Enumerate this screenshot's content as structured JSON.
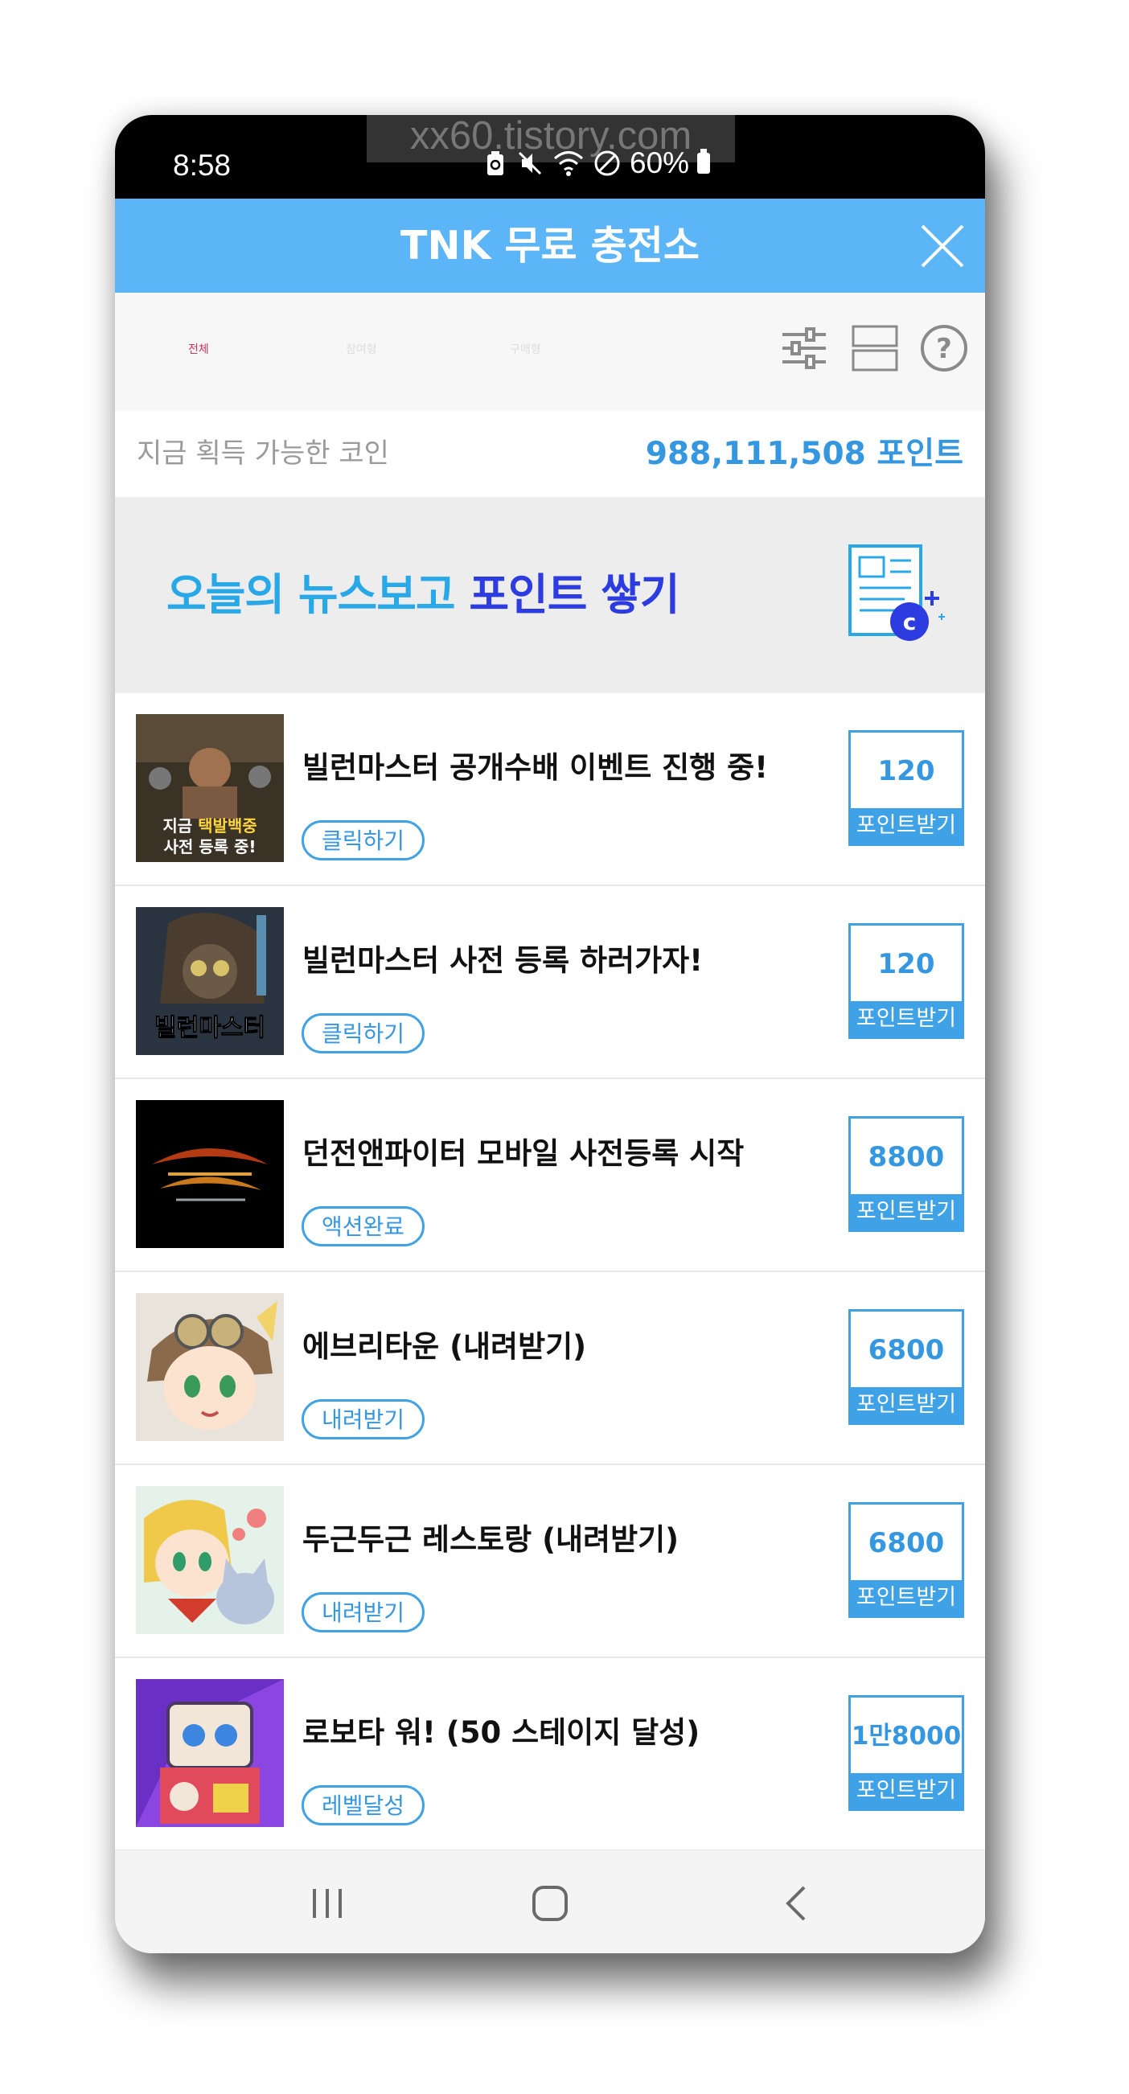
{
  "status_bar": {
    "time": "8:58",
    "battery": "60%",
    "watermark": "xx60.tistory.com"
  },
  "header": {
    "title": "TNK 무료 충전소"
  },
  "tabs": [
    {
      "label": "전체",
      "active": true
    },
    {
      "label": "참여형",
      "active": false
    },
    {
      "label": "구매형",
      "active": false
    }
  ],
  "points": {
    "label": "지금 획득 가능한 코인",
    "value": "988,111,508 포인트"
  },
  "banner": {
    "text_part1": "오늘의 뉴스보고 ",
    "text_part2": "포인트 쌓기"
  },
  "offers": [
    {
      "title": "빌런마스터 공개수배 이벤트 진행 중!",
      "action": "클릭하기",
      "reward": "120",
      "reward_label": "포인트받기"
    },
    {
      "title": "빌런마스터 사전 등록 하러가자!",
      "action": "클릭하기",
      "reward": "120",
      "reward_label": "포인트받기"
    },
    {
      "title": "던전앤파이터 모바일 사전등록 시작",
      "action": "액션완료",
      "reward": "8800",
      "reward_label": "포인트받기"
    },
    {
      "title": "에브리타운 (내려받기)",
      "action": "내려받기",
      "reward": "6800",
      "reward_label": "포인트받기"
    },
    {
      "title": "두근두근 레스토랑 (내려받기)",
      "action": "내려받기",
      "reward": "6800",
      "reward_label": "포인트받기"
    },
    {
      "title": "로보타 워! (50 스테이지 달성)",
      "action": "레벨달성",
      "reward": "1만8000",
      "reward_label": "포인트받기"
    }
  ],
  "thumb_text": {
    "offer1_line1": "지금 ",
    "offer1_highlight": "택발백중",
    "offer1_line2": "사전 등록 중!",
    "offer2": "빌런마스터"
  },
  "colors": {
    "accent": "#5cb5f7",
    "button_blue": "#3fa2e6",
    "points_blue": "#3597e0",
    "tab_active": "#c9365a"
  },
  "icons": [
    "close-icon",
    "filter-icon",
    "view-toggle-icon",
    "help-icon",
    "news-coin-icon",
    "recents-icon",
    "home-icon",
    "back-icon"
  ]
}
